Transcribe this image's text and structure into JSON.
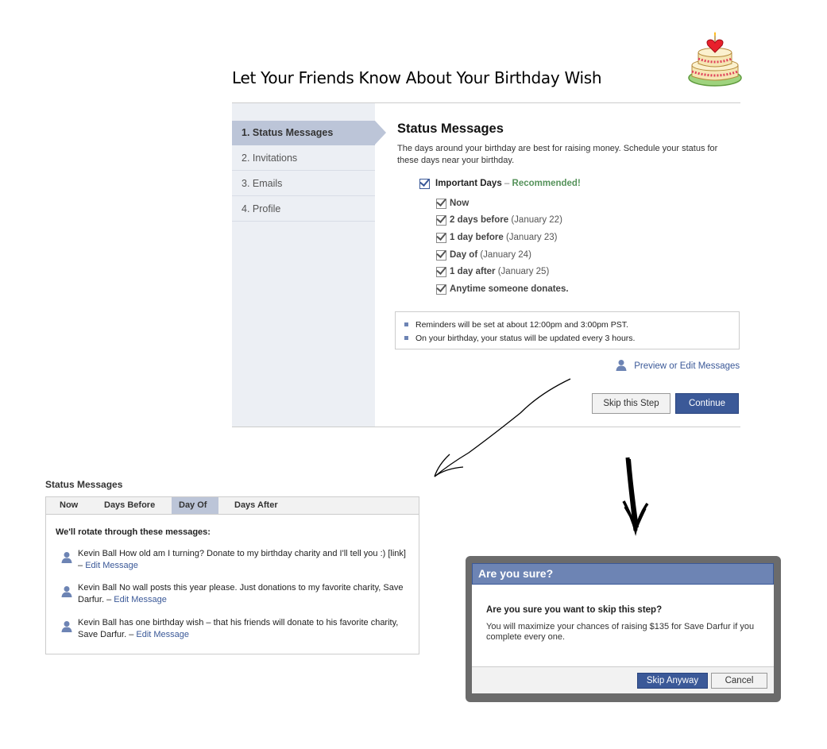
{
  "header": {
    "title": "Let Your Friends Know About Your Birthday Wish"
  },
  "wizard": {
    "steps": [
      {
        "label": "1. Status Messages"
      },
      {
        "label": "2. Invitations"
      },
      {
        "label": "3. Emails"
      },
      {
        "label": "4. Profile"
      }
    ],
    "active_step": 1,
    "title": "Status Messages",
    "description": "The days around your birthday are best for raising money. Schedule your status for these days near your birthday.",
    "important_days": {
      "label": "Important Days",
      "separator": " – ",
      "recommended": "Recommended!",
      "checked": true
    },
    "options": [
      {
        "bold": "Now",
        "detail": "",
        "checked": true
      },
      {
        "bold": "2 days before",
        "detail": " (January 22)",
        "checked": true
      },
      {
        "bold": "1 day before",
        "detail": " (January 23)",
        "checked": true
      },
      {
        "bold": "Day of",
        "detail": " (January 24)",
        "checked": true
      },
      {
        "bold": "1 day after",
        "detail": " (January 25)",
        "checked": true
      },
      {
        "bold": "Anytime someone donates.",
        "detail": "",
        "checked": true
      }
    ],
    "notes": [
      "Reminders will be set at about 12:00pm and 3:00pm PST.",
      "On your birthday, your status will be updated every 3 hours."
    ],
    "preview_link": "Preview or Edit Messages",
    "skip_button": "Skip this Step",
    "continue_button": "Continue"
  },
  "preview": {
    "title": "Status Messages",
    "tabs": [
      "Now",
      "Days Before",
      "Day Of",
      "Days After"
    ],
    "selected_tab": "Day Of",
    "intro": "We'll rotate through these messages:",
    "messages": [
      {
        "text": "Kevin Ball How old am I turning? Donate to my birthday charity and I'll tell you :) [link] – ",
        "edit": "Edit Message"
      },
      {
        "text": "Kevin Ball No wall posts this year please. Just donations to my favorite charity, Save Darfur. – ",
        "edit": "Edit Message"
      },
      {
        "text": "Kevin Ball has one birthday wish – that his friends will donate to his favorite charity, Save Darfur. – ",
        "edit": "Edit Message"
      }
    ]
  },
  "dialog": {
    "title": "Are you sure?",
    "question": "Are you sure you want to skip this step?",
    "text": "You will maximize your chances of raising $135 for Save Darfur if you complete every one.",
    "primary_button": "Skip Anyway",
    "cancel_button": "Cancel"
  },
  "icons": {
    "cake": "birthday-cake-icon",
    "person": "person-icon",
    "checkbox": "checkbox-checked-icon"
  },
  "colors": {
    "brand_blue": "#3b5998",
    "dialog_header": "#6d84b4",
    "sidebar_bg": "#eceff4",
    "active_step": "#bcc5d8",
    "recommended_green": "#55925a"
  }
}
